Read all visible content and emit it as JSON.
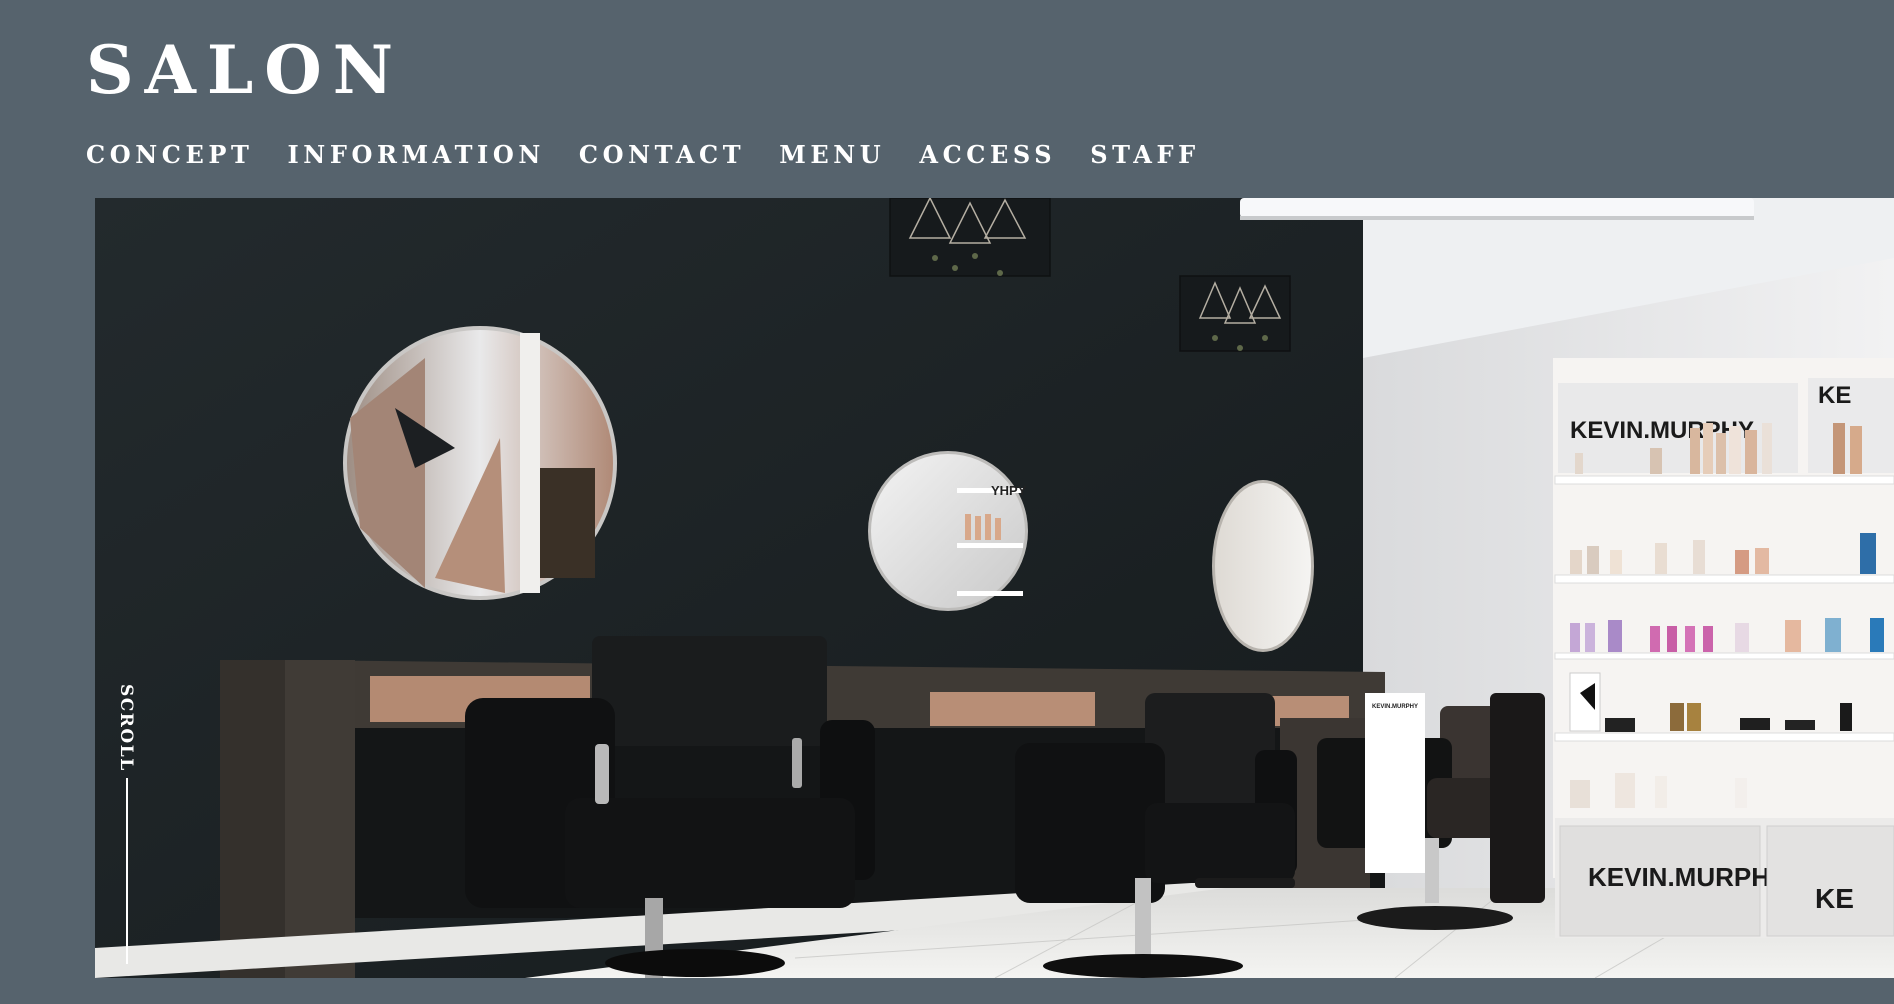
{
  "header": {
    "logo": "SALON",
    "nav": [
      {
        "label": "CONCEPT"
      },
      {
        "label": "INFORMATION"
      },
      {
        "label": "CONTACT"
      },
      {
        "label": "MENU"
      },
      {
        "label": "ACCESS"
      },
      {
        "label": "STAFF"
      }
    ]
  },
  "hero": {
    "shelf_brand_top": "KEVIN.MURPHY",
    "shelf_brand_top_partial": "KE",
    "shelf_brand_bottom": "KEVIN.MURPHY",
    "shelf_brand_bottom_partial": "KE",
    "mirror_text": "YHPY",
    "small_box_text": "KEVIN.MURPHY"
  },
  "scroll": {
    "label": "SCROLL"
  },
  "colors": {
    "background": "#56636d",
    "text": "#ffffff",
    "wall": "#1c2225"
  }
}
